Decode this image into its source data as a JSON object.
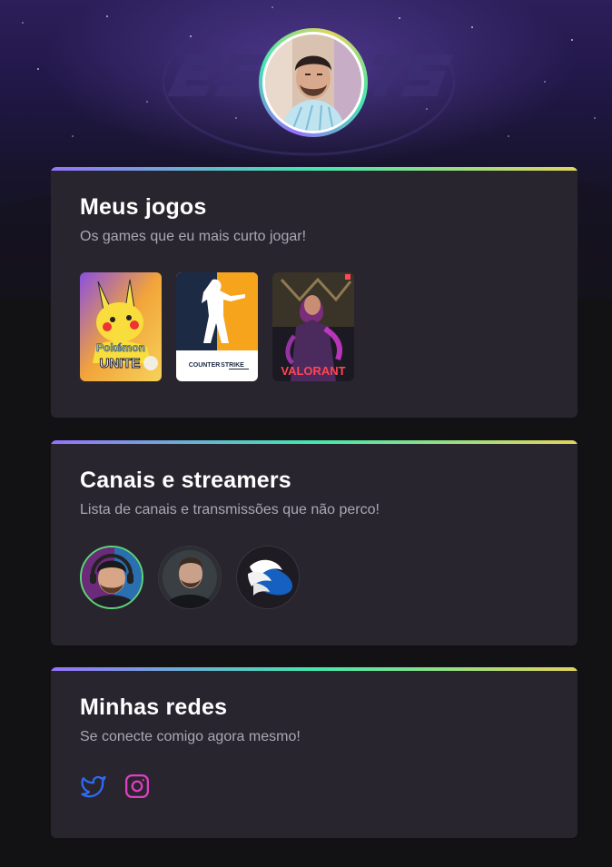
{
  "profile": {
    "avatar_alt": "profile-photo"
  },
  "sections": {
    "games": {
      "title": "Meus jogos",
      "subtitle": "Os games que eu mais curto jogar!",
      "items": [
        {
          "name": "Pokémon UNITE",
          "logo_line1": "Pokémon",
          "logo_line2": "UNITE"
        },
        {
          "name": "Counter-Strike",
          "logo_line1": "COUNTER",
          "logo_line2": "STRIKE"
        },
        {
          "name": "VALORANT",
          "logo_line1": "VALORANT"
        }
      ]
    },
    "streamers": {
      "title": "Canais e streamers",
      "subtitle": "Lista de canais e transmissões que não perco!",
      "items": [
        {
          "icon": "streamer-avatar-1"
        },
        {
          "icon": "streamer-avatar-2"
        },
        {
          "icon": "streamer-avatar-3"
        }
      ]
    },
    "social": {
      "title": "Minhas redes",
      "subtitle": "Se conecte comigo agora mesmo!",
      "items": [
        {
          "icon": "twitter-icon",
          "color": "#2e6cf6"
        },
        {
          "icon": "instagram-icon",
          "color": "#e13ec2"
        }
      ]
    }
  },
  "colors": {
    "background": "#121214",
    "card": "#29252f",
    "gradient_start": "#9572fc",
    "gradient_mid": "#43e7ad",
    "gradient_end": "#e2d45c",
    "title": "#ffffff",
    "subtitle": "#a8a8b3"
  }
}
